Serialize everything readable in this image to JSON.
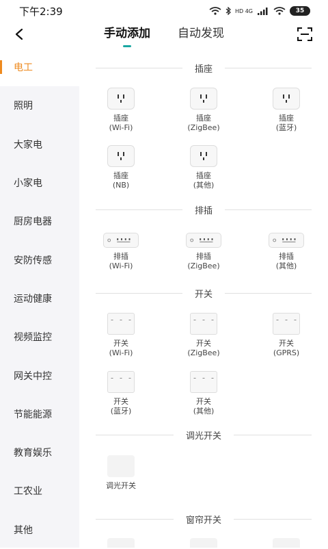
{
  "status": {
    "time": "下午2:39",
    "battery": "35",
    "network": "HD 4G"
  },
  "header": {
    "tabs": [
      {
        "label": "手动添加"
      },
      {
        "label": "自动发现"
      }
    ]
  },
  "sidebar": {
    "items": [
      {
        "label": "电工"
      },
      {
        "label": "照明"
      },
      {
        "label": "大家电"
      },
      {
        "label": "小家电"
      },
      {
        "label": "厨房电器"
      },
      {
        "label": "安防传感"
      },
      {
        "label": "运动健康"
      },
      {
        "label": "视频监控"
      },
      {
        "label": "网关中控"
      },
      {
        "label": "节能能源"
      },
      {
        "label": "教育娱乐"
      },
      {
        "label": "工农业"
      },
      {
        "label": "其他"
      }
    ]
  },
  "sections": {
    "socket": {
      "title": "插座",
      "items": [
        {
          "l1": "插座",
          "l2": "(Wi-Fi)"
        },
        {
          "l1": "插座",
          "l2": "(ZigBee)"
        },
        {
          "l1": "插座",
          "l2": "(蓝牙)"
        },
        {
          "l1": "插座",
          "l2": "(NB)"
        },
        {
          "l1": "插座",
          "l2": "(其他)"
        }
      ]
    },
    "strip": {
      "title": "排插",
      "items": [
        {
          "l1": "排插",
          "l2": "(Wi-Fi)"
        },
        {
          "l1": "排插",
          "l2": "(ZigBee)"
        },
        {
          "l1": "排插",
          "l2": "(其他)"
        }
      ]
    },
    "switch": {
      "title": "开关",
      "items": [
        {
          "l1": "开关",
          "l2": "(Wi-Fi)"
        },
        {
          "l1": "开关",
          "l2": "(ZigBee)"
        },
        {
          "l1": "开关",
          "l2": "(GPRS)"
        },
        {
          "l1": "开关",
          "l2": "(蓝牙)"
        },
        {
          "l1": "开关",
          "l2": "(其他)"
        }
      ]
    },
    "dimmer": {
      "title": "调光开关",
      "items": [
        {
          "l1": "调光开关"
        }
      ]
    },
    "curtain": {
      "title": "窗帘开关"
    }
  }
}
